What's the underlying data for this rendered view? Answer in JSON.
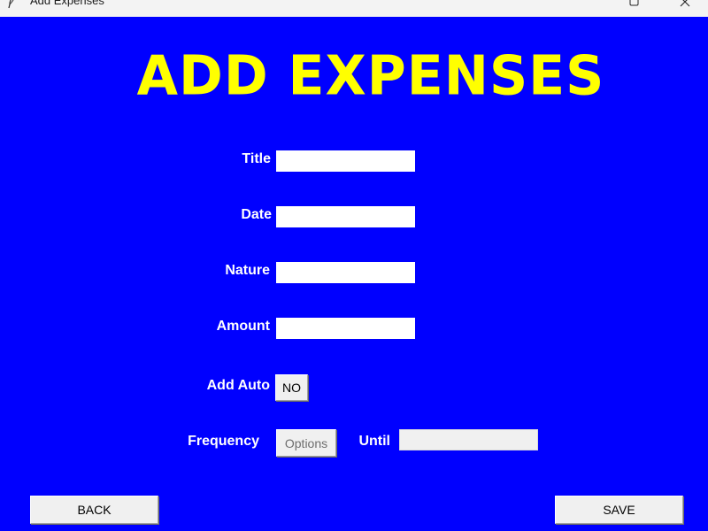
{
  "window": {
    "title": "Add Expenses"
  },
  "colors": {
    "background": "#0000ff",
    "heading": "#ffff00",
    "label": "#ffffff"
  },
  "heading": "ADD EXPENSES",
  "form": {
    "title_label": "Title",
    "title_value": "",
    "date_label": "Date",
    "date_value": "",
    "nature_label": "Nature",
    "nature_value": "",
    "amount_label": "Amount",
    "amount_value": "",
    "add_auto_label": "Add Auto",
    "add_auto_toggle": "NO",
    "frequency_label": "Frequency",
    "frequency_selected": "Options",
    "until_label": "Until",
    "until_value": ""
  },
  "buttons": {
    "back": "BACK",
    "save": "SAVE"
  },
  "icons": {
    "app": "feather-icon",
    "maximize": "maximize-icon",
    "close": "close-icon"
  }
}
